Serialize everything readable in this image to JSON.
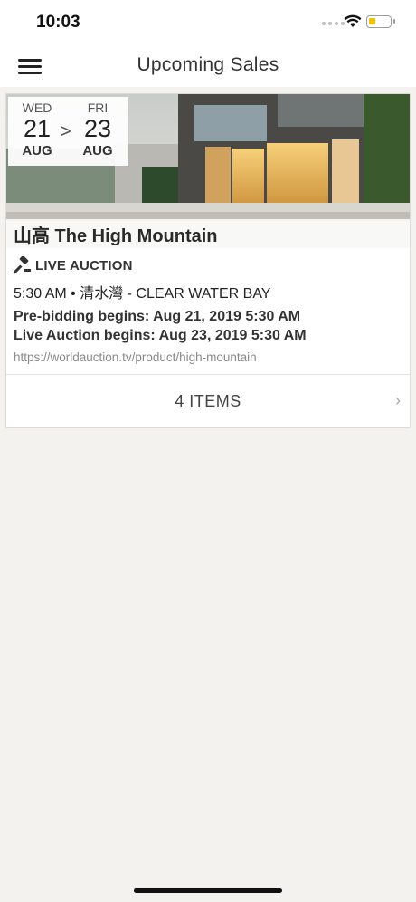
{
  "status_bar": {
    "time": "10:03",
    "battery_color": "#f5c400"
  },
  "nav": {
    "title": "Upcoming Sales",
    "menu_icon": "hamburger-menu-icon"
  },
  "sale": {
    "start": {
      "weekday": "WED",
      "day": "21",
      "month": "AUG"
    },
    "separator": ">",
    "end": {
      "weekday": "FRI",
      "day": "23",
      "month": "AUG"
    },
    "title": "山高 The High Mountain",
    "auction_type": "LIVE AUCTION",
    "auction_icon": "gavel-icon",
    "time_location": "5:30 AM • 清水灣 - CLEAR WATER BAY",
    "prebidding": "Pre-bidding begins: Aug 21, 2019 5:30 AM",
    "live_auction": "Live Auction begins: Aug 23, 2019 5:30 AM",
    "url": "https://worldauction.tv/product/high-mountain",
    "items_label": "4 ITEMS",
    "chevron": "›"
  }
}
